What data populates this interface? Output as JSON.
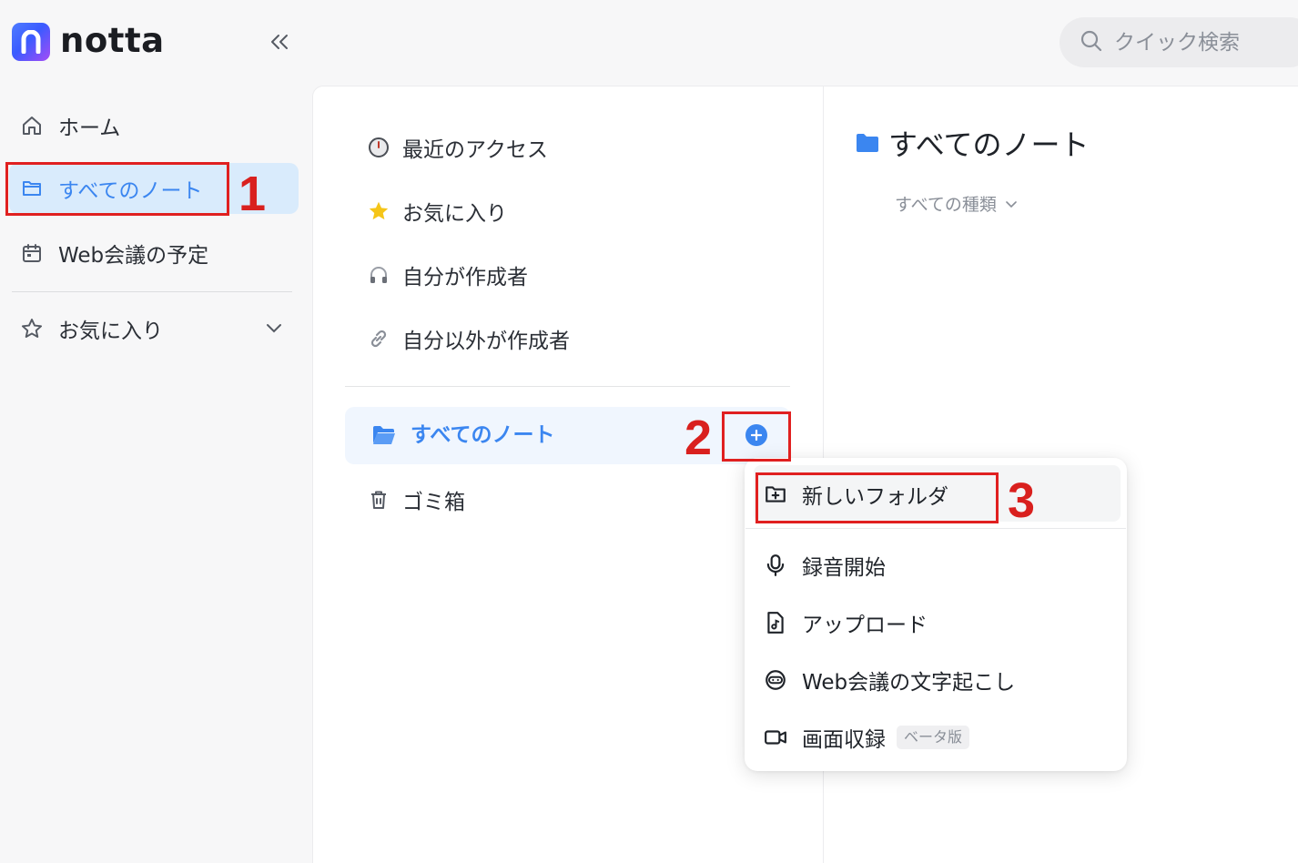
{
  "app": {
    "name": "notta"
  },
  "search": {
    "placeholder": "クイック検索"
  },
  "sidebar": {
    "items": [
      {
        "label": "ホーム",
        "icon": "home-icon"
      },
      {
        "label": "すべてのノート",
        "icon": "folder-icon",
        "active": true
      },
      {
        "label": "Web会議の予定",
        "icon": "calendar-icon"
      }
    ],
    "favorites_label": "お気に入り"
  },
  "middle": {
    "items": [
      {
        "label": "最近のアクセス",
        "icon": "clock-icon"
      },
      {
        "label": "お気に入り",
        "icon": "star-icon"
      },
      {
        "label": "自分が作成者",
        "icon": "headphones-icon"
      },
      {
        "label": "自分以外が作成者",
        "icon": "link-icon"
      }
    ],
    "active_folder": "すべてのノート",
    "trash": "ゴミ箱"
  },
  "right": {
    "title": "すべてのノート",
    "filter": "すべての種類"
  },
  "menu": {
    "items": [
      {
        "label": "新しいフォルダ",
        "icon": "new-folder-icon"
      },
      {
        "label": "録音開始",
        "icon": "microphone-icon"
      },
      {
        "label": "アップロード",
        "icon": "upload-file-icon"
      },
      {
        "label": "Web会議の文字起こし",
        "icon": "meeting-bot-icon"
      },
      {
        "label": "画面収録",
        "icon": "video-icon",
        "badge": "ベータ版"
      }
    ]
  },
  "annotations": {
    "step1": "1",
    "step2": "2",
    "step3": "3"
  },
  "colors": {
    "accent": "#3b86f0",
    "active_bg": "#d9ebfc",
    "annotation": "#e02020"
  }
}
